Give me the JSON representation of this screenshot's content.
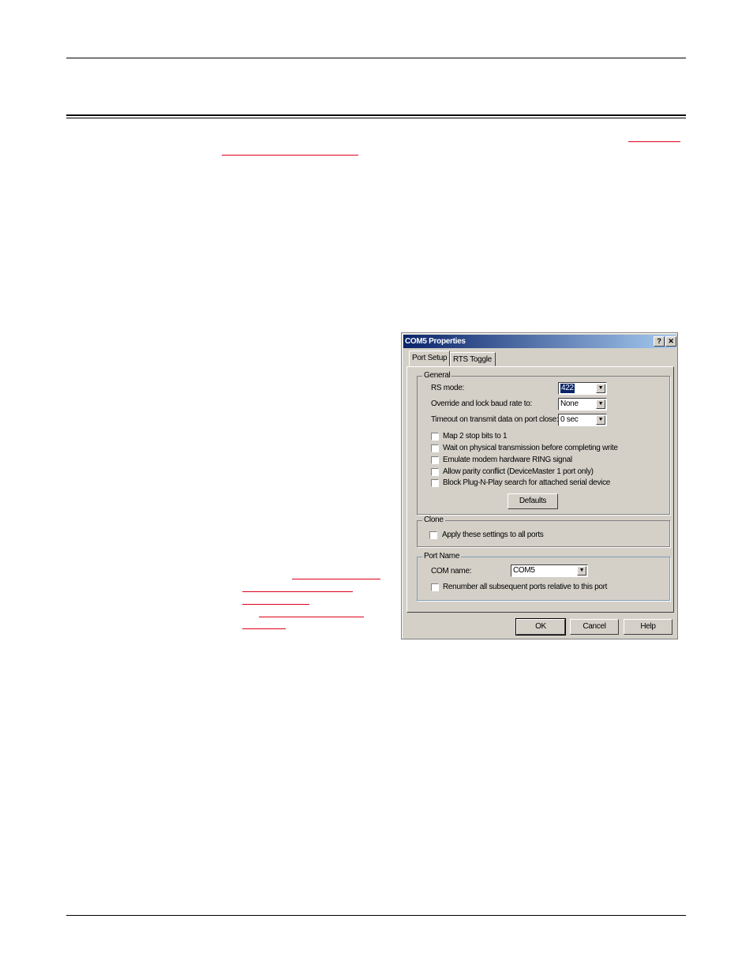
{
  "dialog": {
    "title": "COM5 Properties",
    "help_button": "?",
    "close_button": "✕",
    "tabs": [
      {
        "label": "Port Setup",
        "active": true
      },
      {
        "label": "RTS Toggle",
        "active": false
      }
    ],
    "general": {
      "legend": "General",
      "rs_mode": {
        "label": "RS mode:",
        "value": "422"
      },
      "baud_rate": {
        "label": "Override and lock baud rate to:",
        "value": "None"
      },
      "timeout": {
        "label": "Timeout on transmit data on port close:",
        "value": "0 sec"
      },
      "checkboxes": [
        {
          "label": "Map 2 stop bits to 1",
          "checked": false
        },
        {
          "label": "Wait on physical transmission before completing write",
          "checked": false
        },
        {
          "label": "Emulate modem hardware RING signal",
          "checked": false
        },
        {
          "label": "Allow parity conflict (DeviceMaster 1 port only)",
          "checked": false
        },
        {
          "label": "Block Plug-N-Play search for attached serial device",
          "checked": false
        }
      ],
      "defaults_button": "Defaults"
    },
    "clone": {
      "legend": "Clone",
      "checkbox_label": "Apply these settings to all ports"
    },
    "port_name": {
      "legend": "Port Name",
      "com_name_label": "COM name:",
      "com_name_value": "COM5",
      "renumber_label": "Renumber all subsequent ports relative to this port"
    },
    "buttons": {
      "ok": "OK",
      "cancel": "Cancel",
      "help": "Help"
    }
  },
  "colors": {
    "titlebar_start": "#0a246a",
    "titlebar_end": "#a6caf0",
    "dialog_face": "#d4d0c8",
    "link_red": "#e0001a"
  }
}
